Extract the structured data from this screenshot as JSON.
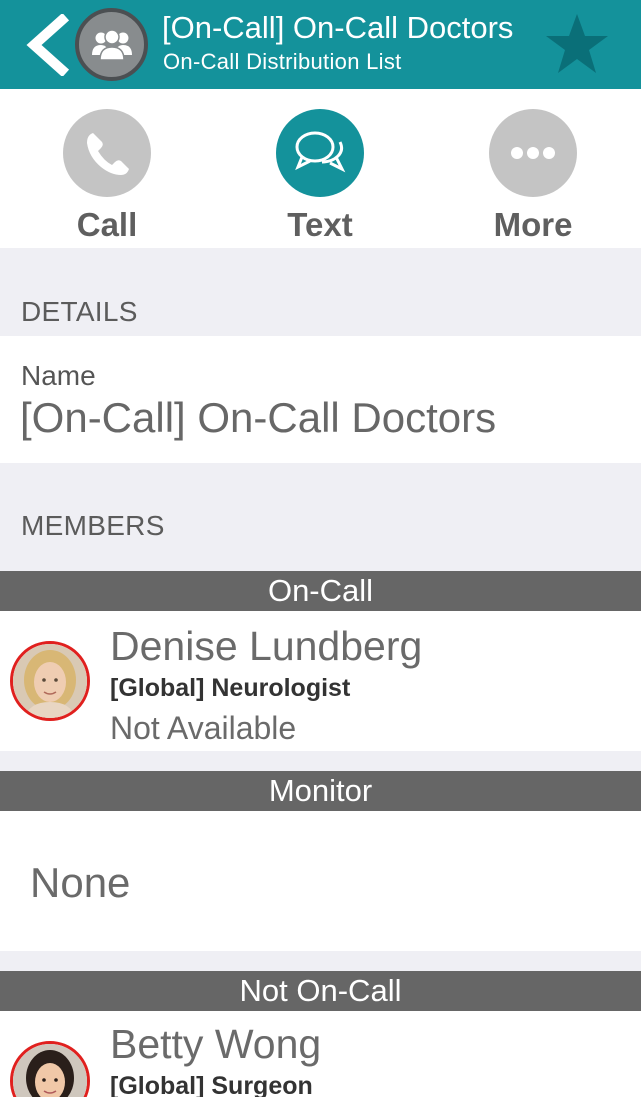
{
  "header": {
    "title": "[On-Call] On-Call Doctors",
    "subtitle": "On-Call Distribution List",
    "back_icon": "chevron-left-icon",
    "group_icon": "group-icon",
    "favorite_icon": "star-icon",
    "color": "#14929b"
  },
  "actions": [
    {
      "label": "Call",
      "icon": "phone-icon",
      "color": "#c4c4c4"
    },
    {
      "label": "Text",
      "icon": "chat-bubbles-icon",
      "color": "#14929b"
    },
    {
      "label": "More",
      "icon": "ellipsis-icon",
      "color": "#c4c4c4"
    }
  ],
  "details": {
    "section_title": "DETAILS",
    "name_label": "Name",
    "name_value": "[On-Call] On-Call Doctors"
  },
  "members": {
    "section_title": "MEMBERS",
    "groups": [
      {
        "title": "On-Call",
        "people": [
          {
            "name": "Denise Lundberg",
            "role": "[Global] Neurologist",
            "status": "Not Available",
            "status_color": "#e0201e"
          }
        ]
      },
      {
        "title": "Monitor",
        "empty_text": "None"
      },
      {
        "title": "Not On-Call",
        "people": [
          {
            "name": "Betty Wong",
            "role": "[Global] Surgeon",
            "status_color": "#e0201e"
          }
        ]
      }
    ]
  }
}
